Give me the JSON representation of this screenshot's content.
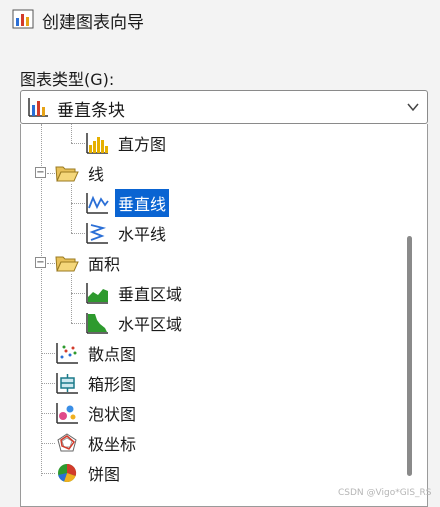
{
  "window": {
    "title": "创建图表向导",
    "icon": "chart-wizard-icon"
  },
  "chart_type_label": "图表类型(G):",
  "combo": {
    "selected": "垂直条块",
    "icon": "bar-chart-icon"
  },
  "tree": {
    "items": [
      {
        "label": "直方图",
        "icon": "histogram-icon"
      },
      {
        "label": "线",
        "icon": "folder-open-icon"
      },
      {
        "label": "垂直线",
        "icon": "vertical-line-icon",
        "selected": true
      },
      {
        "label": "水平线",
        "icon": "horizontal-line-icon"
      },
      {
        "label": "面积",
        "icon": "folder-open-icon"
      },
      {
        "label": "垂直区域",
        "icon": "vertical-area-icon"
      },
      {
        "label": "水平区域",
        "icon": "horizontal-area-icon"
      },
      {
        "label": "散点图",
        "icon": "scatter-icon"
      },
      {
        "label": "箱形图",
        "icon": "box-plot-icon"
      },
      {
        "label": "泡状图",
        "icon": "bubble-icon"
      },
      {
        "label": "极坐标",
        "icon": "polar-icon"
      },
      {
        "label": "饼图",
        "icon": "pie-icon"
      }
    ]
  },
  "watermark": "CSDN @Vigo*GIS_RS"
}
